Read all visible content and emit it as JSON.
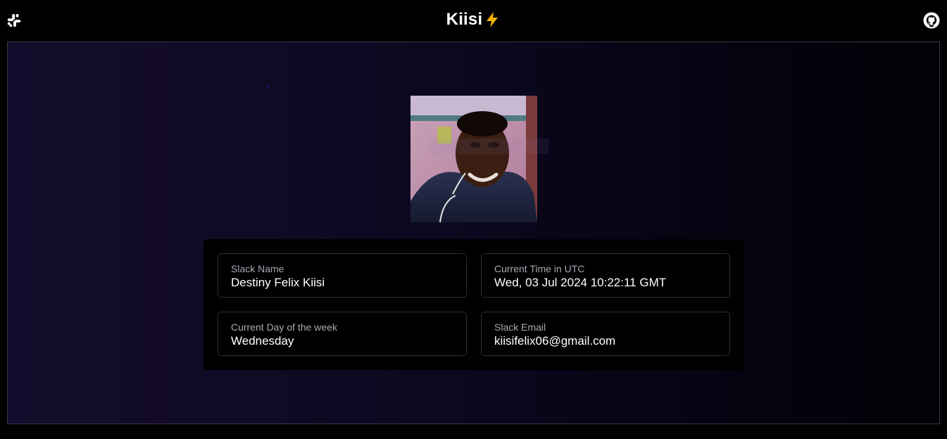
{
  "header": {
    "brand_name": "Kiisi",
    "brand_emoji": "⚡",
    "left_icon": "slack-icon",
    "right_icon": "github-icon"
  },
  "profile": {
    "photo_alt": "Profile photo"
  },
  "info": {
    "slack_name": {
      "label": "Slack Name",
      "value": "Destiny Felix Kiisi"
    },
    "utc_time": {
      "label": "Current Time in UTC",
      "value": "Wed, 03 Jul 2024 10:22:11 GMT"
    },
    "day_of_week": {
      "label": "Current Day of the week",
      "value": "Wednesday"
    },
    "slack_email": {
      "label": "Slack Email",
      "value": "kiisifelix06@gmail.com"
    }
  },
  "colors": {
    "background": "#000000",
    "stage_gradient_start": "#140c2c",
    "card_bg": "#000000",
    "label_text": "#a8a8b4",
    "bolt": "#f5b301"
  }
}
